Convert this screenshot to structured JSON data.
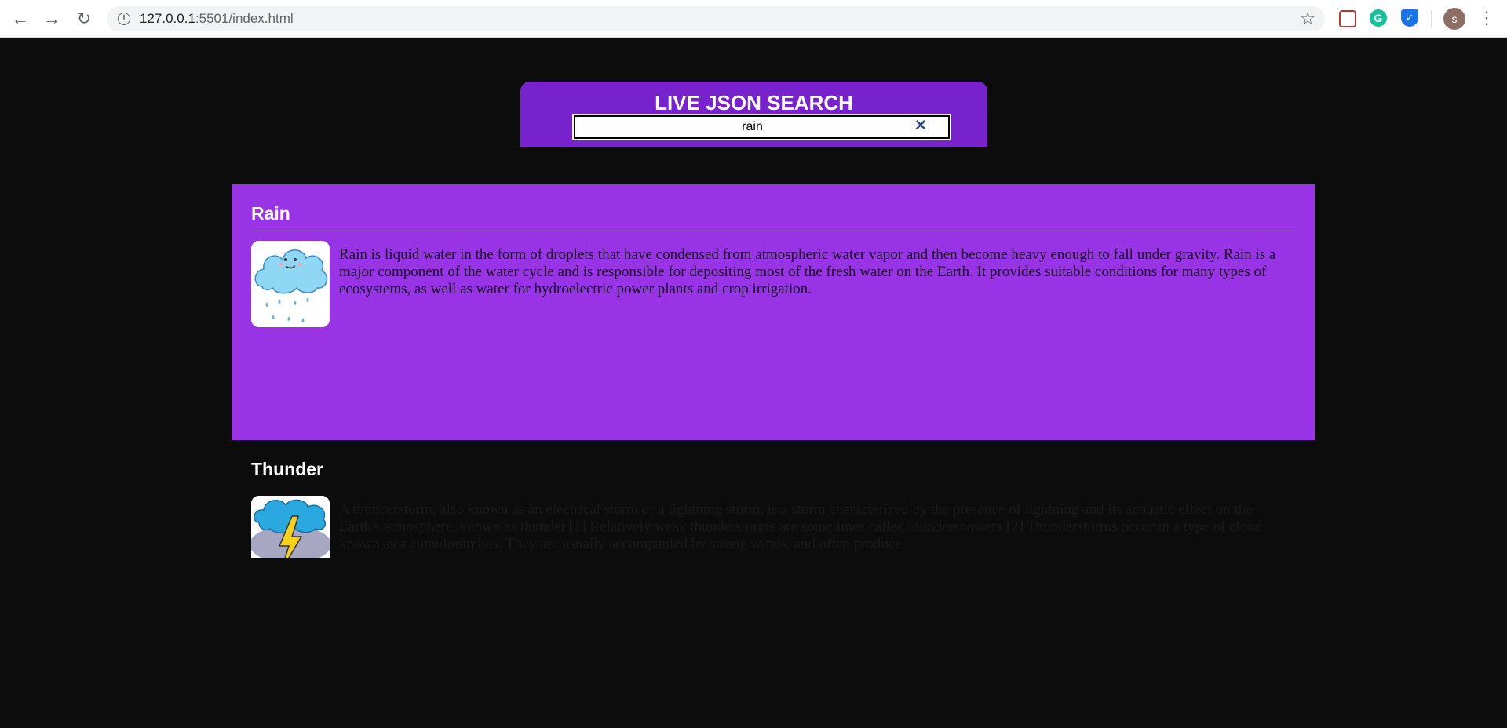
{
  "browser": {
    "url_host": "127.0.0.1",
    "url_rest": ":5501/index.html",
    "avatar_letter": "s",
    "info_glyph": "i"
  },
  "search": {
    "title": "LIVE JSON SEARCH",
    "query": "rain",
    "clear_glyph": "✕"
  },
  "results": [
    {
      "title": "Rain",
      "description": "Rain is liquid water in the form of droplets that have condensed from atmospheric water vapor and then become heavy enough to fall under gravity. Rain is a major component of the water cycle and is responsible for depositing most of the fresh water on the Earth. It provides suitable conditions for many types of ecosystems, as well as water for hydroelectric power plants and crop irrigation.",
      "image_icon": "rain-cloud-icon"
    },
    {
      "title": "Thunder",
      "description": "A thunderstorm, also known as an electrical storm or a lightning storm, is a storm characterized by the presence of lightning and its acoustic effect on the Earth's atmosphere, known as thunder.[1] Relatively weak thunderstorms are sometimes called thundershowers.[2] Thunderstorms occur in a type of cloud known as a cumulonimbus. They are usually accompanied by strong winds, and often produce",
      "image_icon": "thunder-cloud-icon"
    }
  ],
  "colors": {
    "page_bg": "#0c0c0c",
    "header_bg": "#7722cc",
    "active_result_bg": "#9933e6"
  }
}
